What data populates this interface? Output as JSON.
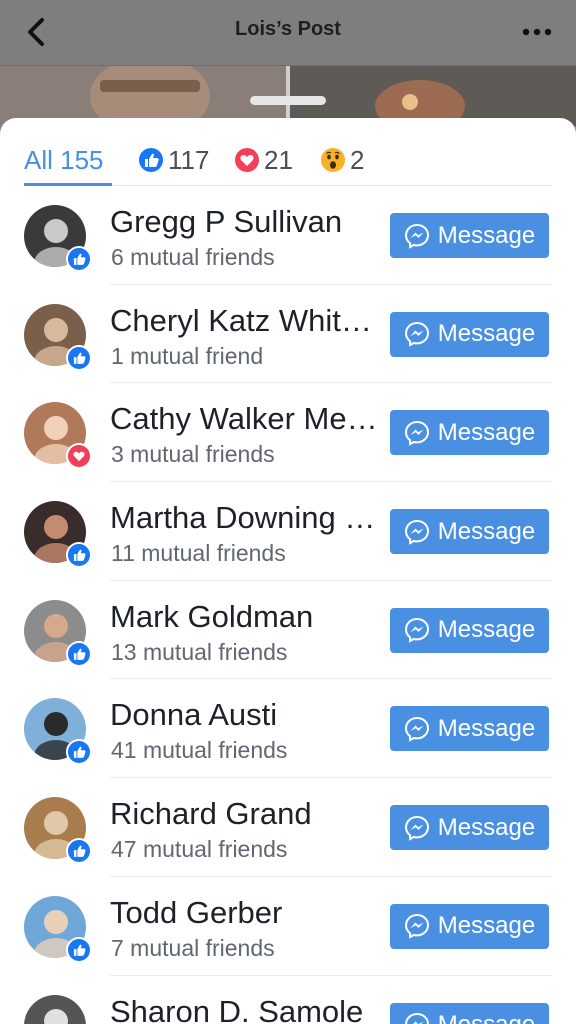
{
  "nav": {
    "title": "Lois’s Post",
    "back_icon": "chevron-left-icon",
    "more_icon": "more-horizontal-icon"
  },
  "tabs": {
    "all": "All 155",
    "like_count": "117",
    "love_count": "21",
    "wow_count": "2"
  },
  "colors": {
    "accent": "#4a90e2",
    "like": "#1877f2",
    "love": "#f33e58",
    "wow": "#f7b125"
  },
  "message_label": "Message",
  "people": [
    {
      "name": "Gregg P Sullivan",
      "mutual": "6 mutual friends",
      "reaction": "like-icon"
    },
    {
      "name": "Cheryl Katz Whitman",
      "mutual": "1 mutual friend",
      "reaction": "like-icon"
    },
    {
      "name": "Cathy Walker Meyers",
      "mutual": "3 mutual friends",
      "reaction": "heart-icon"
    },
    {
      "name": "Martha Downing Fischer",
      "mutual": "11 mutual friends",
      "reaction": "like-icon"
    },
    {
      "name": "Mark Goldman",
      "mutual": "13 mutual friends",
      "reaction": "like-icon"
    },
    {
      "name": "Donna Austi",
      "mutual": "41 mutual friends",
      "reaction": "like-icon"
    },
    {
      "name": "Richard Grand",
      "mutual": "47 mutual friends",
      "reaction": "like-icon"
    },
    {
      "name": "Todd Gerber",
      "mutual": "7 mutual friends",
      "reaction": "like-icon"
    },
    {
      "name": "Sharon D. Samole",
      "mutual": "",
      "reaction": "like-icon"
    }
  ]
}
